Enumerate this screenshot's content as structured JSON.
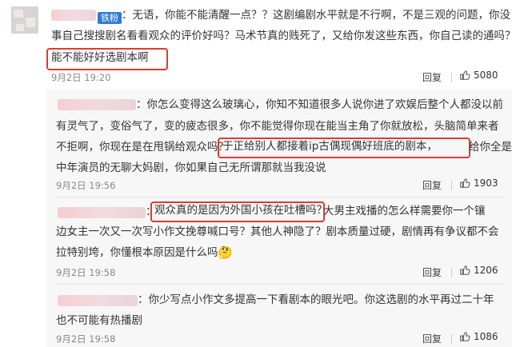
{
  "main_comment": {
    "badge": "铁粉",
    "line1": "：无语，你能不能清醒一点？？这剧编剧水平就是不行啊，不是三观的问题，你没",
    "line2": "事自己搜搜剧名看看观众的评价好吗？马术节真的贱死了，又给你发这些东西，你自己读的通吗？",
    "highlight": "能不能好好选剧本啊",
    "time": "9月2日 19:20",
    "reply_label": "回复",
    "like_count": "5080"
  },
  "replies": [
    {
      "line1": "：你怎么变得这么玻璃心，你知不知道很多人说你进了欢娱后整个人都没以前",
      "line2": "有灵气了，变俗气了，变的疲态很多，你不能觉得你现在能当主角了你就放松，头脑简单来者",
      "line3_a": "不拒啊，你现在是在甩锅给观众吗？",
      "line3_highlight": "于正给别人都接着ip古偶现偶好班底的剧本，",
      "line3_b": "给你全是搭",
      "line4": "中年演员的无聊大妈剧，你如果自己无所谓那就当我没说",
      "time": "9月2日 19:56",
      "reply_label": "回复",
      "like_count": "1903"
    },
    {
      "prefix": "：",
      "highlight": "观众真的是因为外国小孩在吐槽吗？",
      "line1_b": "大男主戏播的怎么样需要你一个镶",
      "line2": "边女主一次又一次写小作文挽尊喊口号？其他人神隐了？剧本质量过硬，剧情再有争议都不会",
      "line3": "拉特别垮，你懂根本原因是什么吗",
      "emoji": "🤔",
      "time": "9月2日 19:58",
      "reply_label": "回复",
      "like_count": "1206"
    },
    {
      "line1": "：你少写点小作文多提高一下看剧本的眼光吧。你这选剧的水平再过二十年",
      "line2": "也不可能有热播剧",
      "time": "9月2日 19:58",
      "reply_label": "回复",
      "like_count": "1086"
    }
  ],
  "icons": {
    "reply": "reply-icon",
    "like": "thumbs-up-icon"
  },
  "colors": {
    "highlight_border": "#e03a2f",
    "badge_bg": "#2f7bd8",
    "reply_panel_bg": "#f7f7f7"
  }
}
